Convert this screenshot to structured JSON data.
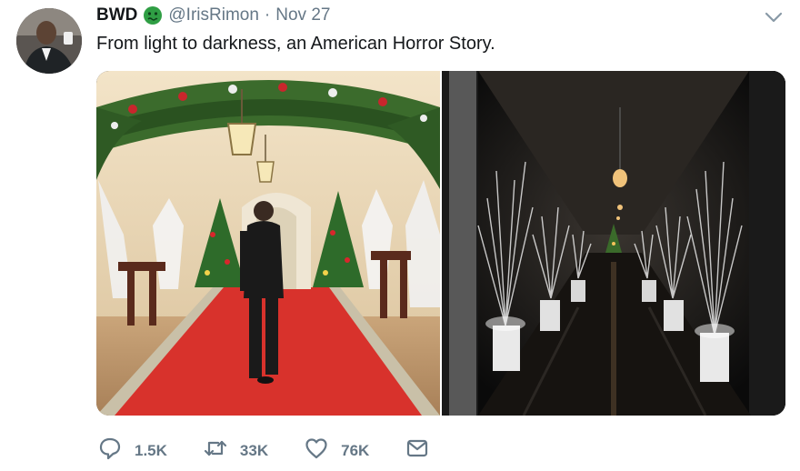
{
  "tweet": {
    "display_name": "BWD",
    "handle": "@IrisRimon",
    "separator": "·",
    "date": "Nov 27",
    "text": "From light to darkness, an American Horror Story."
  },
  "icons": {
    "badge": "sick-face-emoji",
    "menu": "chevron-down-icon",
    "reply": "reply-icon",
    "retweet": "retweet-icon",
    "like": "heart-icon",
    "message": "mail-icon"
  },
  "actions": {
    "replies": "1.5K",
    "retweets": "33K",
    "likes": "76K"
  },
  "colors": {
    "text": "#14171a",
    "secondary": "#657786",
    "badge_green": "#2f9e44"
  }
}
